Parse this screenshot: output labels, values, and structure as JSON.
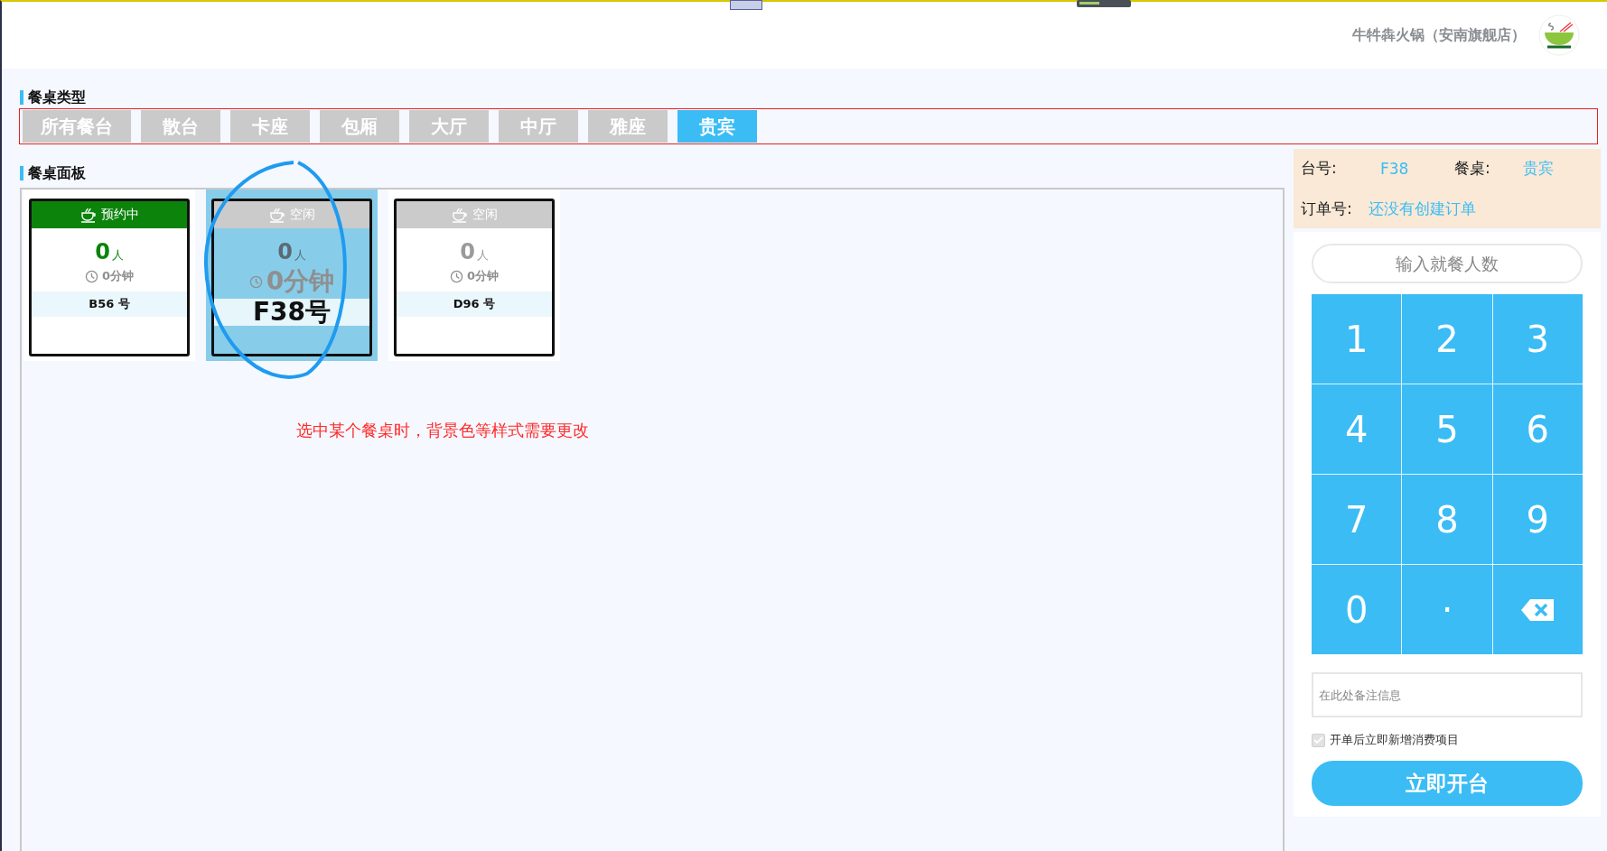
{
  "header": {
    "store_name": "牛牪犇火锅（安南旗舰店）"
  },
  "table_types": {
    "title": "餐桌类型",
    "tabs": [
      {
        "label": "所有餐台",
        "selected": false
      },
      {
        "label": "散台",
        "selected": false
      },
      {
        "label": "卡座",
        "selected": false
      },
      {
        "label": "包厢",
        "selected": false
      },
      {
        "label": "大厅",
        "selected": false
      },
      {
        "label": "中厅",
        "selected": false
      },
      {
        "label": "雅座",
        "selected": false
      },
      {
        "label": "贵宾",
        "selected": true
      }
    ]
  },
  "table_panel": {
    "title": "餐桌面板",
    "tables": [
      {
        "status": "预约中",
        "kind": "reserved",
        "people": "0",
        "unit": "人",
        "time": "0分钟",
        "name": "B56 号",
        "selected": false
      },
      {
        "status": "空闲",
        "kind": "free",
        "people": "0",
        "unit": "人",
        "time": "0分钟",
        "name": "F38号",
        "selected": true
      },
      {
        "status": "空闲",
        "kind": "free",
        "people": "0",
        "unit": "人",
        "time": "0分钟",
        "name": "D96 号",
        "selected": false
      }
    ],
    "annotation": "选中某个餐桌时，背景色等样式需要更改"
  },
  "order_panel": {
    "table_no_label": "台号:",
    "table_no": "F38",
    "table_type_label": "餐桌:",
    "table_type": "贵宾",
    "order_no_label": "订单号:",
    "order_no": "还没有创建订单",
    "guests": {
      "placeholder": "输入就餐人数"
    },
    "keypad": [
      {
        "kind": "key",
        "label": "1"
      },
      {
        "kind": "key",
        "label": "2"
      },
      {
        "kind": "key",
        "label": "3"
      },
      {
        "kind": "key",
        "label": "4"
      },
      {
        "kind": "key",
        "label": "5"
      },
      {
        "kind": "key",
        "label": "6"
      },
      {
        "kind": "key",
        "label": "7"
      },
      {
        "kind": "key",
        "label": "8"
      },
      {
        "kind": "key",
        "label": "9"
      },
      {
        "kind": "key",
        "label": "0"
      },
      {
        "kind": "key",
        "label": "·"
      },
      {
        "kind": "backspace"
      }
    ],
    "note": {
      "placeholder": "在此处备注信息"
    },
    "add_items": {
      "label": "开单后立即新增消费项目",
      "checked": true,
      "disabled": true
    },
    "open_button": "立即开台"
  }
}
